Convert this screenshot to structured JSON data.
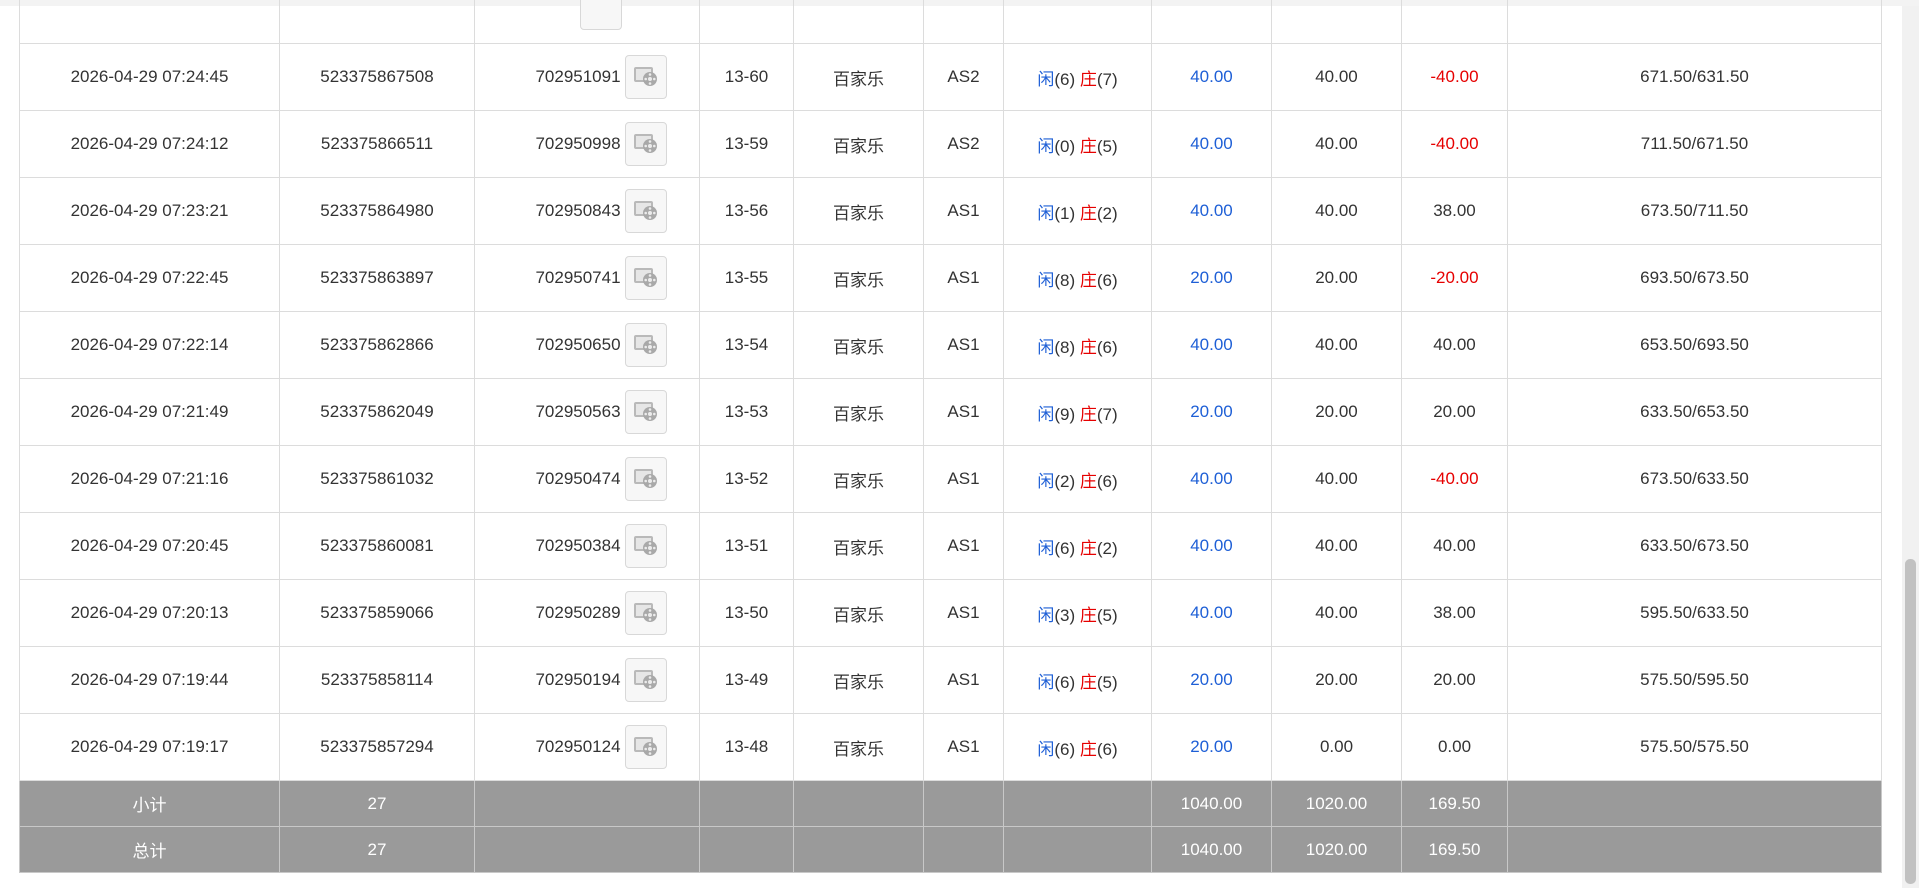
{
  "colors": {
    "player": "#1e5fd6",
    "banker": "#e60000",
    "loss": "#e60000",
    "summary_bg": "#9a9a9a"
  },
  "rows": [
    {
      "time": "2026-04-29 07:24:45",
      "bet_id": "523375867508",
      "round_id": "702951091",
      "shoe": "13-60",
      "game": "百家乐",
      "table": "AS2",
      "player_label": "闲",
      "player_pts": "(6)",
      "banker_label": "庄",
      "banker_pts": "(7)",
      "bet": "40.00",
      "valid": "40.00",
      "win": "-40.00",
      "win_neg": true,
      "balance": "671.50/631.50"
    },
    {
      "time": "2026-04-29 07:24:12",
      "bet_id": "523375866511",
      "round_id": "702950998",
      "shoe": "13-59",
      "game": "百家乐",
      "table": "AS2",
      "player_label": "闲",
      "player_pts": "(0)",
      "banker_label": "庄",
      "banker_pts": "(5)",
      "bet": "40.00",
      "valid": "40.00",
      "win": "-40.00",
      "win_neg": true,
      "balance": "711.50/671.50"
    },
    {
      "time": "2026-04-29 07:23:21",
      "bet_id": "523375864980",
      "round_id": "702950843",
      "shoe": "13-56",
      "game": "百家乐",
      "table": "AS1",
      "player_label": "闲",
      "player_pts": "(1)",
      "banker_label": "庄",
      "banker_pts": "(2)",
      "bet": "40.00",
      "valid": "40.00",
      "win": "38.00",
      "win_neg": false,
      "balance": "673.50/711.50"
    },
    {
      "time": "2026-04-29 07:22:45",
      "bet_id": "523375863897",
      "round_id": "702950741",
      "shoe": "13-55",
      "game": "百家乐",
      "table": "AS1",
      "player_label": "闲",
      "player_pts": "(8)",
      "banker_label": "庄",
      "banker_pts": "(6)",
      "bet": "20.00",
      "valid": "20.00",
      "win": "-20.00",
      "win_neg": true,
      "balance": "693.50/673.50"
    },
    {
      "time": "2026-04-29 07:22:14",
      "bet_id": "523375862866",
      "round_id": "702950650",
      "shoe": "13-54",
      "game": "百家乐",
      "table": "AS1",
      "player_label": "闲",
      "player_pts": "(8)",
      "banker_label": "庄",
      "banker_pts": "(6)",
      "bet": "40.00",
      "valid": "40.00",
      "win": "40.00",
      "win_neg": false,
      "balance": "653.50/693.50"
    },
    {
      "time": "2026-04-29 07:21:49",
      "bet_id": "523375862049",
      "round_id": "702950563",
      "shoe": "13-53",
      "game": "百家乐",
      "table": "AS1",
      "player_label": "闲",
      "player_pts": "(9)",
      "banker_label": "庄",
      "banker_pts": "(7)",
      "bet": "20.00",
      "valid": "20.00",
      "win": "20.00",
      "win_neg": false,
      "balance": "633.50/653.50"
    },
    {
      "time": "2026-04-29 07:21:16",
      "bet_id": "523375861032",
      "round_id": "702950474",
      "shoe": "13-52",
      "game": "百家乐",
      "table": "AS1",
      "player_label": "闲",
      "player_pts": "(2)",
      "banker_label": "庄",
      "banker_pts": "(6)",
      "bet": "40.00",
      "valid": "40.00",
      "win": "-40.00",
      "win_neg": true,
      "balance": "673.50/633.50"
    },
    {
      "time": "2026-04-29 07:20:45",
      "bet_id": "523375860081",
      "round_id": "702950384",
      "shoe": "13-51",
      "game": "百家乐",
      "table": "AS1",
      "player_label": "闲",
      "player_pts": "(6)",
      "banker_label": "庄",
      "banker_pts": "(2)",
      "bet": "40.00",
      "valid": "40.00",
      "win": "40.00",
      "win_neg": false,
      "balance": "633.50/673.50"
    },
    {
      "time": "2026-04-29 07:20:13",
      "bet_id": "523375859066",
      "round_id": "702950289",
      "shoe": "13-50",
      "game": "百家乐",
      "table": "AS1",
      "player_label": "闲",
      "player_pts": "(3)",
      "banker_label": "庄",
      "banker_pts": "(5)",
      "bet": "40.00",
      "valid": "40.00",
      "win": "38.00",
      "win_neg": false,
      "balance": "595.50/633.50"
    },
    {
      "time": "2026-04-29 07:19:44",
      "bet_id": "523375858114",
      "round_id": "702950194",
      "shoe": "13-49",
      "game": "百家乐",
      "table": "AS1",
      "player_label": "闲",
      "player_pts": "(6)",
      "banker_label": "庄",
      "banker_pts": "(5)",
      "bet": "20.00",
      "valid": "20.00",
      "win": "20.00",
      "win_neg": false,
      "balance": "575.50/595.50"
    },
    {
      "time": "2026-04-29 07:19:17",
      "bet_id": "523375857294",
      "round_id": "702950124",
      "shoe": "13-48",
      "game": "百家乐",
      "table": "AS1",
      "player_label": "闲",
      "player_pts": "(6)",
      "banker_label": "庄",
      "banker_pts": "(6)",
      "bet": "20.00",
      "valid": "0.00",
      "win": "0.00",
      "win_neg": false,
      "balance": "575.50/575.50"
    }
  ],
  "subtotal": {
    "label": "小计",
    "count": "27",
    "bet": "1040.00",
    "valid": "1020.00",
    "win": "169.50"
  },
  "total": {
    "label": "总计",
    "count": "27",
    "bet": "1040.00",
    "valid": "1020.00",
    "win": "169.50"
  }
}
